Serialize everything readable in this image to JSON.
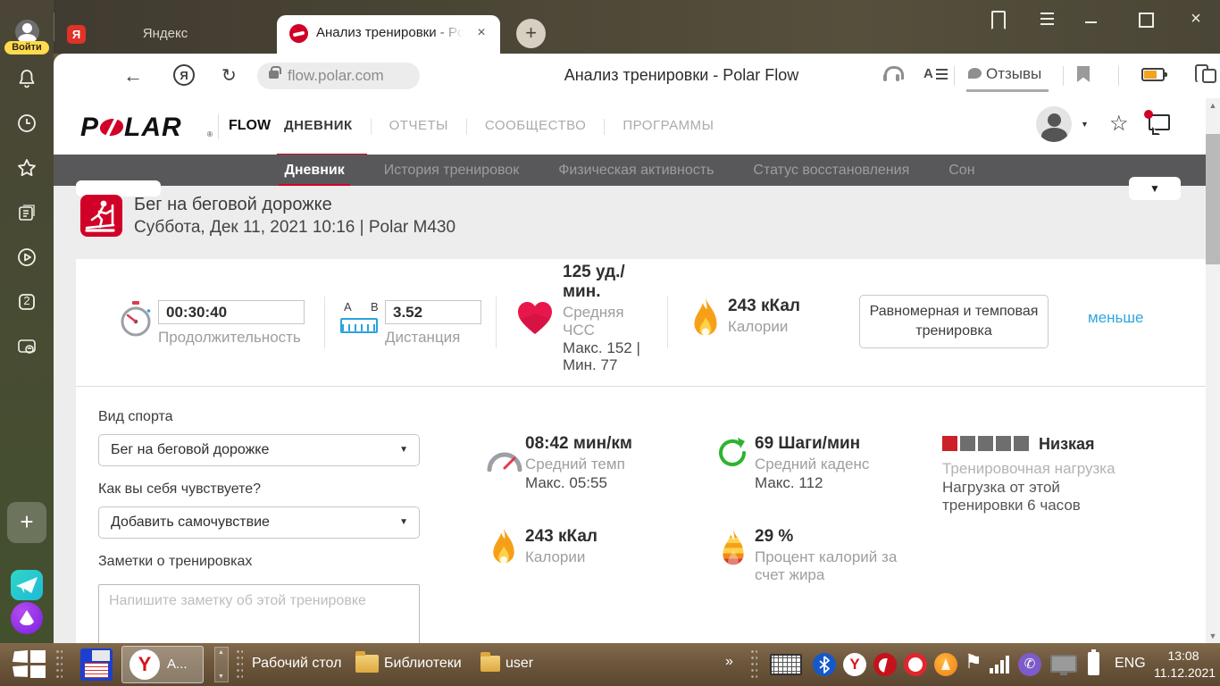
{
  "colors": {
    "accent_red": "#d10027",
    "link_blue": "#2fa7dc",
    "subnav_gray": "#58585a",
    "load_red": "#cd2129"
  },
  "browser": {
    "sidebar": {
      "login_label": "Войти",
      "tab_count": "2"
    },
    "tabs": {
      "inactive_tab": "Яндекс",
      "active_tab": "Анализ тренировки - Polar Flow"
    },
    "address_bar": {
      "url": "flow.polar.com",
      "page_title": "Анализ тренировки - Polar Flow",
      "feedback_label": "Отзывы"
    }
  },
  "polar": {
    "header": {
      "logo_left": "P",
      "logo_right": "LAR",
      "flow": "FLOW",
      "nav": [
        {
          "label": "ДНЕВНИК"
        },
        {
          "label": "ОТЧЕТЫ"
        },
        {
          "label": "СООБЩЕСТВО"
        },
        {
          "label": "ПРОГРАММЫ"
        }
      ]
    },
    "subnav": [
      {
        "label": "Дневник"
      },
      {
        "label": "История тренировок"
      },
      {
        "label": "Физическая активность"
      },
      {
        "label": "Статус восстановления"
      },
      {
        "label": "Сон"
      }
    ],
    "training": {
      "title": "Бег на беговой дорожке",
      "subtitle": "Суббота, Дек 11, 2021 10:16 | Polar M430"
    },
    "summary": {
      "duration": {
        "value": "00:30:40",
        "label": "Продолжительность"
      },
      "distance": {
        "value": "3.52",
        "label": "Дистанция",
        "a": "A",
        "b": "B"
      },
      "heart_rate": {
        "value_line1": "125 уд./",
        "value_line2": "мин.",
        "label": "Средняя ЧСС",
        "range": "Макс. 152  |  Мин. 77"
      },
      "calories": {
        "value": "243 кКал",
        "label": "Калории"
      },
      "benefit_button": "Равномерная и темповая тренировка",
      "less_link": "меньше"
    },
    "form": {
      "sport_label": "Вид спорта",
      "sport_value": "Бег на беговой дорожке",
      "feeling_label": "Как вы себя чувствуете?",
      "feeling_value": "Добавить самочувствие",
      "notes_label": "Заметки о тренировках",
      "notes_placeholder": "Напишите заметку об этой тренировке"
    },
    "details": {
      "pace": {
        "value": "08:42 мин/км",
        "label": "Средний темп",
        "max": "Макс. 05:55"
      },
      "cadence": {
        "value": "69 Шаги/мин",
        "label": "Средний каденс",
        "max": "Макс. 112"
      },
      "calories": {
        "value": "243 кКал",
        "label": "Калории"
      },
      "fat": {
        "value": "29 %",
        "label": "Процент калорий за счет жира"
      }
    },
    "load": {
      "level": "Низкая",
      "label": "Тренировочная нагрузка",
      "desc": "Нагрузка от этой тренировки 6 часов",
      "squares_filled": 1,
      "squares_total": 5
    }
  },
  "taskbar": {
    "task_label": "A...",
    "desktop_label": "Рабочий стол",
    "libraries_label": "Библиотеки",
    "user_label": "user",
    "lang": "ENG",
    "time": "13:08",
    "date": "11.12.2021"
  }
}
